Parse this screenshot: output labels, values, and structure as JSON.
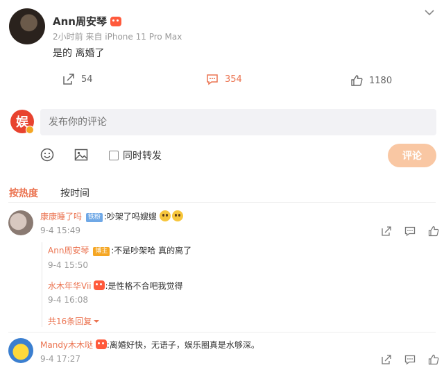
{
  "post": {
    "author": "Ann周安琴",
    "time": "2小时前",
    "source": "来自 iPhone 11 Pro Max",
    "text": "是的 离婚了",
    "repost_count": "54",
    "comment_count": "354",
    "like_count": "1180"
  },
  "composer": {
    "placeholder": "发布你的评论",
    "repost_label": "同时转发",
    "submit_label": "评论"
  },
  "sort_tabs": {
    "hot": "按热度",
    "time": "按时间"
  },
  "comments": [
    {
      "user": "康康睡了吗",
      "badge": "铁粉",
      "text": ":吵架了吗嫂嫂",
      "time": "9-4 15:49",
      "replies": [
        {
          "user": "Ann周安琴",
          "badge": "博主",
          "text": ":不是吵架哈 真的离了",
          "time": "9-4 15:50"
        },
        {
          "user": "水木年华Vii",
          "text": ":是性格不合吧我觉得",
          "time": "9-4 16:08"
        }
      ],
      "more_replies": "共16条回复"
    },
    {
      "user": "Mandy木木哒",
      "text": ":离婚好快，无语子，娱乐圈真是水够深。",
      "time": "9-4 17:27"
    }
  ],
  "colors": {
    "accent": "#eb7350",
    "link": "#eb7350",
    "submit_bg": "#f9c7a3"
  }
}
